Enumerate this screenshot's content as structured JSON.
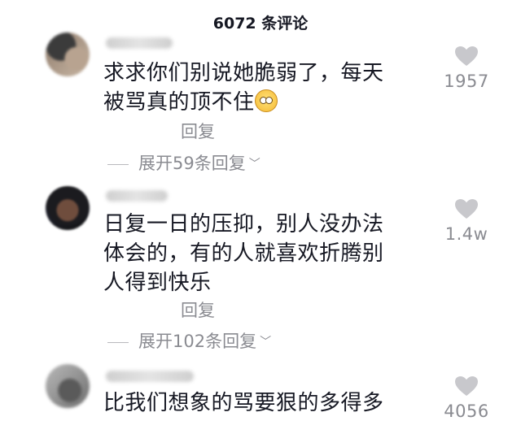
{
  "header": {
    "title": "6072 条评论"
  },
  "comments": [
    {
      "text_line1": "求求你们别说她脆弱了，每天",
      "text_line2": "被骂真的顶不住",
      "emoji": "pleading-face-icon",
      "likes": "1957",
      "reply_label": "回复",
      "expand_label": "展开59条回复"
    },
    {
      "text_line1": "日复一日的压抑，别人没办法",
      "text_line2": "体会的，有的人就喜欢折腾别",
      "text_line3": "人得到快乐",
      "likes": "1.4w",
      "reply_label": "回复",
      "expand_label": "展开102条回复"
    },
    {
      "text_line1": "比我们想象的骂要狠的多得多",
      "likes": "4056"
    }
  ],
  "colors": {
    "text": "#161823",
    "secondary": "#8a8b91",
    "heart": "#c8c8cc"
  }
}
